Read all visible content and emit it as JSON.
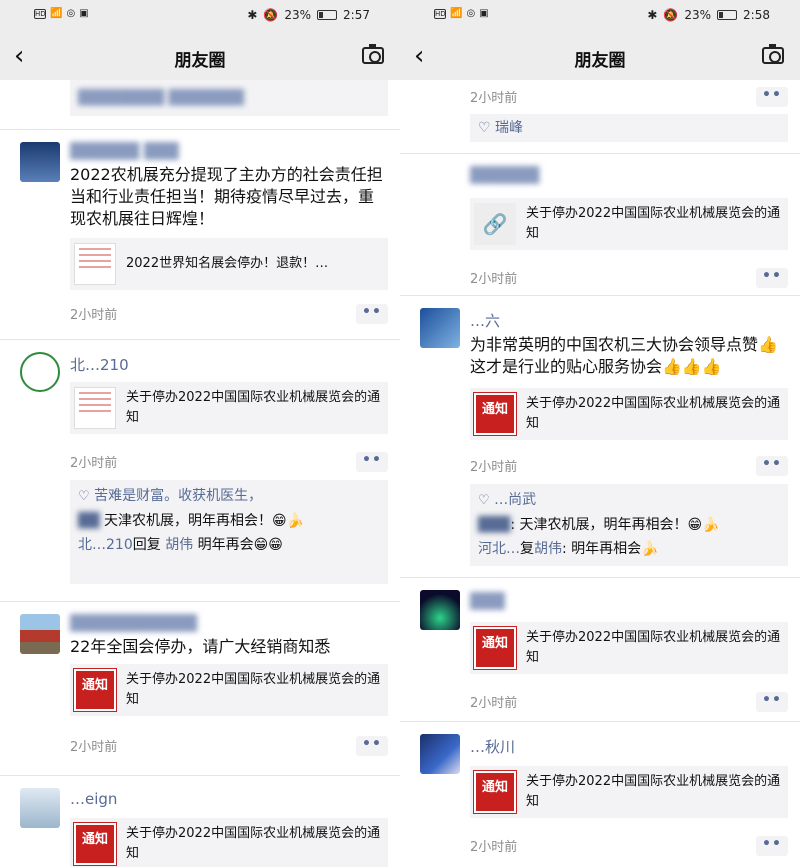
{
  "status": {
    "left_icons": [
      "HD",
      "4G",
      "signal",
      "wifi",
      "nfc"
    ],
    "battery": "23%",
    "time_left": "2:57",
    "time_right": "2:58"
  },
  "nav": {
    "title": "朋友圈"
  },
  "left": {
    "top_fragment": {
      "line1": "",
      "line2": ""
    },
    "posts": [
      {
        "name": "",
        "text": "2022农机展充分提现了主办方的社会责任担当和行业责任担当！期待疫情尽早过去，重现农机展往日辉煌！",
        "link": "2022世界知名展会停办！退款！…",
        "time": "2小时前"
      },
      {
        "name": "北…210",
        "link": "关于停办2022中国国际农业机械展览会的通知",
        "time": "2小时前",
        "likes": "苦难是财富。收获机医生，",
        "comments": [
          {
            "who": "",
            "text": "天津农机展，明年再相会！😁🍌"
          },
          {
            "who": "北…210",
            "reply": "回复",
            "to": "胡伟",
            "text": "明年再会😁😁"
          }
        ]
      },
      {
        "name": "",
        "text": "22年全国会停办，请广大经销商知悉",
        "link": "关于停办2022中国国际农业机械展览会的通知",
        "time": "2小时前"
      },
      {
        "name": "…eign",
        "link": "关于停办2022中国国际农业机械展览会的通知"
      }
    ]
  },
  "right": {
    "top_fragment": {
      "time": "2小时前",
      "likes": "♡ 瑞峰"
    },
    "posts": [
      {
        "name": "",
        "link": "关于停办2022中国国际农业机械展览会的通知",
        "time": "2小时前"
      },
      {
        "name": "…六",
        "text": "为非常英明的中国农机三大协会领导点赞👍这才是行业的贴心服务协会👍👍👍",
        "link": "关于停办2022中国国际农业机械展览会的通知",
        "time": "2小时前",
        "likes": "…尚武",
        "comments": [
          {
            "who": "",
            "text": ": 天津农机展，明年再相会！😁🍌"
          },
          {
            "who": "河北…",
            "reply": "复",
            "to": "胡伟",
            "text": ": 明年再相会🍌"
          }
        ]
      },
      {
        "name": "",
        "link": "关于停办2022中国国际农业机械展览会的通知",
        "time": "2小时前"
      },
      {
        "name": "…秋川",
        "link": "关于停办2022中国国际农业机械展览会的通知",
        "time": "2小时前"
      }
    ]
  },
  "icons": {
    "back": "chevron-left-icon",
    "camera": "camera-icon",
    "more": "more-dots-icon",
    "like": "heart-icon",
    "link": "link-icon"
  },
  "colors": {
    "nickname": "#576b95",
    "bar_bg": "#ededed",
    "card_bg": "#f3f3f5",
    "notice_red": "#c8201e",
    "time_gray": "#8e8e8e"
  },
  "thumb": {
    "notice": "通知",
    "notice_sub": "通告"
  }
}
